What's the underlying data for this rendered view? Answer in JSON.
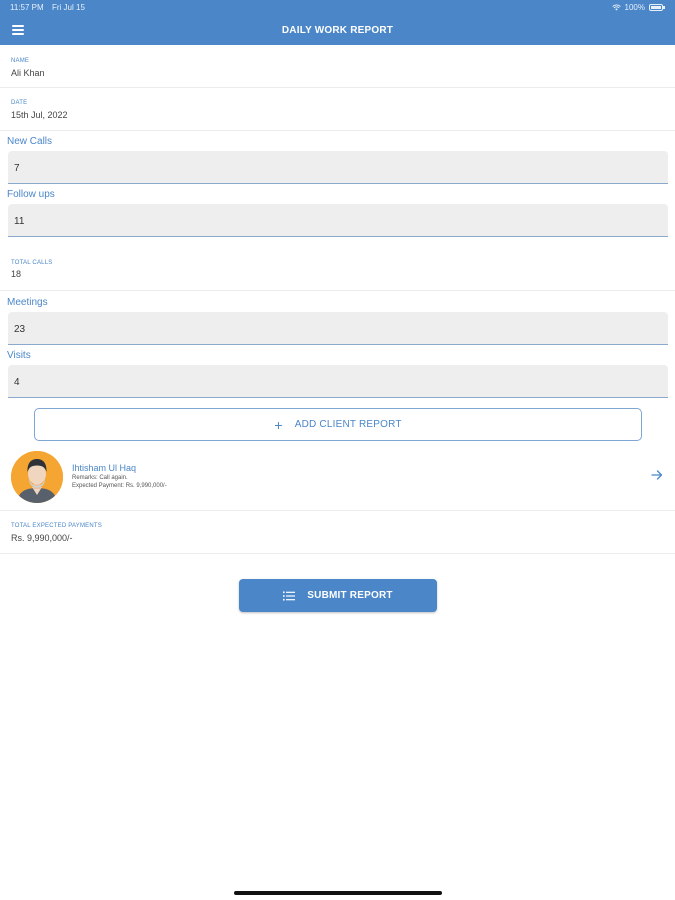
{
  "status_bar": {
    "time": "11:57 PM",
    "date": "Fri Jul 15",
    "battery": "100%"
  },
  "header": {
    "title": "DAILY WORK REPORT"
  },
  "fields": {
    "name": {
      "label": "NAME",
      "value": "Ali Khan"
    },
    "date": {
      "label": "DATE",
      "value": "15th Jul, 2022"
    },
    "new_calls": {
      "label": "New Calls",
      "value": "7"
    },
    "follow_ups": {
      "label": "Follow ups",
      "value": "11"
    },
    "total_calls": {
      "label": "TOTAL CALLS",
      "value": "18"
    },
    "meetings": {
      "label": "Meetings",
      "value": "23"
    },
    "visits": {
      "label": "Visits",
      "value": "4"
    }
  },
  "add_client": {
    "label": "ADD CLIENT REPORT"
  },
  "client": {
    "name": "Ihtisham Ul Haq",
    "remarks": "Remarks: Call again.",
    "payment": "Expected Payment: Rs. 9,990,000/-"
  },
  "total_payments": {
    "label": "TOTAL EXPECTED PAYMENTS",
    "value": "Rs. 9,990,000/-"
  },
  "submit": {
    "label": "SUBMIT REPORT"
  },
  "colors": {
    "accent": "#4a86c8",
    "avatar_bg": "#f5a531"
  },
  "icons": [
    "menu-icon",
    "wifi-icon",
    "battery-icon",
    "plus-icon",
    "arrow-right-icon",
    "list-icon",
    "avatar"
  ]
}
